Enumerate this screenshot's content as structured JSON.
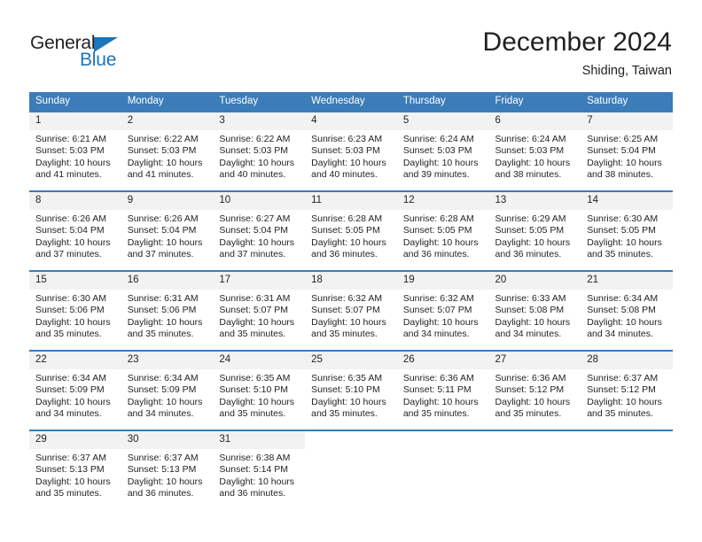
{
  "logo": {
    "word_top": "General",
    "word_bottom": "Blue",
    "triangle_icon": "triangle-icon",
    "blue": "#1b75bb"
  },
  "header": {
    "title": "December 2024",
    "location": "Shiding, Taiwan"
  },
  "theme": {
    "header_bg": "#3b7cb9",
    "daynum_bg": "#f2f2f2",
    "text": "#231f20"
  },
  "weekdays": [
    "Sunday",
    "Monday",
    "Tuesday",
    "Wednesday",
    "Thursday",
    "Friday",
    "Saturday"
  ],
  "weeks": [
    [
      {
        "day": "1",
        "sunrise": "Sunrise: 6:21 AM",
        "sunset": "Sunset: 5:03 PM",
        "daylight1": "Daylight: 10 hours",
        "daylight2": "and 41 minutes."
      },
      {
        "day": "2",
        "sunrise": "Sunrise: 6:22 AM",
        "sunset": "Sunset: 5:03 PM",
        "daylight1": "Daylight: 10 hours",
        "daylight2": "and 41 minutes."
      },
      {
        "day": "3",
        "sunrise": "Sunrise: 6:22 AM",
        "sunset": "Sunset: 5:03 PM",
        "daylight1": "Daylight: 10 hours",
        "daylight2": "and 40 minutes."
      },
      {
        "day": "4",
        "sunrise": "Sunrise: 6:23 AM",
        "sunset": "Sunset: 5:03 PM",
        "daylight1": "Daylight: 10 hours",
        "daylight2": "and 40 minutes."
      },
      {
        "day": "5",
        "sunrise": "Sunrise: 6:24 AM",
        "sunset": "Sunset: 5:03 PM",
        "daylight1": "Daylight: 10 hours",
        "daylight2": "and 39 minutes."
      },
      {
        "day": "6",
        "sunrise": "Sunrise: 6:24 AM",
        "sunset": "Sunset: 5:03 PM",
        "daylight1": "Daylight: 10 hours",
        "daylight2": "and 38 minutes."
      },
      {
        "day": "7",
        "sunrise": "Sunrise: 6:25 AM",
        "sunset": "Sunset: 5:04 PM",
        "daylight1": "Daylight: 10 hours",
        "daylight2": "and 38 minutes."
      }
    ],
    [
      {
        "day": "8",
        "sunrise": "Sunrise: 6:26 AM",
        "sunset": "Sunset: 5:04 PM",
        "daylight1": "Daylight: 10 hours",
        "daylight2": "and 37 minutes."
      },
      {
        "day": "9",
        "sunrise": "Sunrise: 6:26 AM",
        "sunset": "Sunset: 5:04 PM",
        "daylight1": "Daylight: 10 hours",
        "daylight2": "and 37 minutes."
      },
      {
        "day": "10",
        "sunrise": "Sunrise: 6:27 AM",
        "sunset": "Sunset: 5:04 PM",
        "daylight1": "Daylight: 10 hours",
        "daylight2": "and 37 minutes."
      },
      {
        "day": "11",
        "sunrise": "Sunrise: 6:28 AM",
        "sunset": "Sunset: 5:05 PM",
        "daylight1": "Daylight: 10 hours",
        "daylight2": "and 36 minutes."
      },
      {
        "day": "12",
        "sunrise": "Sunrise: 6:28 AM",
        "sunset": "Sunset: 5:05 PM",
        "daylight1": "Daylight: 10 hours",
        "daylight2": "and 36 minutes."
      },
      {
        "day": "13",
        "sunrise": "Sunrise: 6:29 AM",
        "sunset": "Sunset: 5:05 PM",
        "daylight1": "Daylight: 10 hours",
        "daylight2": "and 36 minutes."
      },
      {
        "day": "14",
        "sunrise": "Sunrise: 6:30 AM",
        "sunset": "Sunset: 5:05 PM",
        "daylight1": "Daylight: 10 hours",
        "daylight2": "and 35 minutes."
      }
    ],
    [
      {
        "day": "15",
        "sunrise": "Sunrise: 6:30 AM",
        "sunset": "Sunset: 5:06 PM",
        "daylight1": "Daylight: 10 hours",
        "daylight2": "and 35 minutes."
      },
      {
        "day": "16",
        "sunrise": "Sunrise: 6:31 AM",
        "sunset": "Sunset: 5:06 PM",
        "daylight1": "Daylight: 10 hours",
        "daylight2": "and 35 minutes."
      },
      {
        "day": "17",
        "sunrise": "Sunrise: 6:31 AM",
        "sunset": "Sunset: 5:07 PM",
        "daylight1": "Daylight: 10 hours",
        "daylight2": "and 35 minutes."
      },
      {
        "day": "18",
        "sunrise": "Sunrise: 6:32 AM",
        "sunset": "Sunset: 5:07 PM",
        "daylight1": "Daylight: 10 hours",
        "daylight2": "and 35 minutes."
      },
      {
        "day": "19",
        "sunrise": "Sunrise: 6:32 AM",
        "sunset": "Sunset: 5:07 PM",
        "daylight1": "Daylight: 10 hours",
        "daylight2": "and 34 minutes."
      },
      {
        "day": "20",
        "sunrise": "Sunrise: 6:33 AM",
        "sunset": "Sunset: 5:08 PM",
        "daylight1": "Daylight: 10 hours",
        "daylight2": "and 34 minutes."
      },
      {
        "day": "21",
        "sunrise": "Sunrise: 6:34 AM",
        "sunset": "Sunset: 5:08 PM",
        "daylight1": "Daylight: 10 hours",
        "daylight2": "and 34 minutes."
      }
    ],
    [
      {
        "day": "22",
        "sunrise": "Sunrise: 6:34 AM",
        "sunset": "Sunset: 5:09 PM",
        "daylight1": "Daylight: 10 hours",
        "daylight2": "and 34 minutes."
      },
      {
        "day": "23",
        "sunrise": "Sunrise: 6:34 AM",
        "sunset": "Sunset: 5:09 PM",
        "daylight1": "Daylight: 10 hours",
        "daylight2": "and 34 minutes."
      },
      {
        "day": "24",
        "sunrise": "Sunrise: 6:35 AM",
        "sunset": "Sunset: 5:10 PM",
        "daylight1": "Daylight: 10 hours",
        "daylight2": "and 35 minutes."
      },
      {
        "day": "25",
        "sunrise": "Sunrise: 6:35 AM",
        "sunset": "Sunset: 5:10 PM",
        "daylight1": "Daylight: 10 hours",
        "daylight2": "and 35 minutes."
      },
      {
        "day": "26",
        "sunrise": "Sunrise: 6:36 AM",
        "sunset": "Sunset: 5:11 PM",
        "daylight1": "Daylight: 10 hours",
        "daylight2": "and 35 minutes."
      },
      {
        "day": "27",
        "sunrise": "Sunrise: 6:36 AM",
        "sunset": "Sunset: 5:12 PM",
        "daylight1": "Daylight: 10 hours",
        "daylight2": "and 35 minutes."
      },
      {
        "day": "28",
        "sunrise": "Sunrise: 6:37 AM",
        "sunset": "Sunset: 5:12 PM",
        "daylight1": "Daylight: 10 hours",
        "daylight2": "and 35 minutes."
      }
    ],
    [
      {
        "day": "29",
        "sunrise": "Sunrise: 6:37 AM",
        "sunset": "Sunset: 5:13 PM",
        "daylight1": "Daylight: 10 hours",
        "daylight2": "and 35 minutes."
      },
      {
        "day": "30",
        "sunrise": "Sunrise: 6:37 AM",
        "sunset": "Sunset: 5:13 PM",
        "daylight1": "Daylight: 10 hours",
        "daylight2": "and 36 minutes."
      },
      {
        "day": "31",
        "sunrise": "Sunrise: 6:38 AM",
        "sunset": "Sunset: 5:14 PM",
        "daylight1": "Daylight: 10 hours",
        "daylight2": "and 36 minutes."
      },
      null,
      null,
      null,
      null
    ]
  ]
}
